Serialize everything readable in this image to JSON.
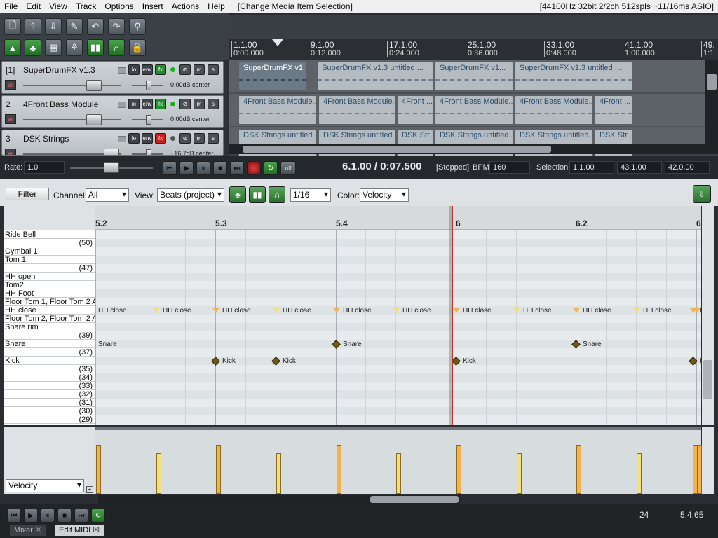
{
  "menu": {
    "items": [
      "File",
      "Edit",
      "View",
      "Track",
      "Options",
      "Insert",
      "Actions",
      "Help"
    ],
    "status": "[Change Media Item Selection]",
    "audio": "[44100Hz 32bit 2/2ch 512spls ~11/16ms ASIO]"
  },
  "tracks": [
    {
      "num": "[1]",
      "name": "SuperDrumFX v1.3",
      "vol": "0.00dB",
      "pan": "center",
      "fx_color": "green",
      "clips": [
        {
          "label": "SuperDrumFX v1...",
          "sel": true
        },
        {
          "label": "SuperDrumFX v1.3 untitled ..."
        },
        {
          "label": "SuperDrumFX v1..."
        },
        {
          "label": "SuperDrumFX v1.3 untitled ..."
        }
      ]
    },
    {
      "num": "2",
      "name": "4Front Bass Module",
      "vol": "0.00dB",
      "pan": "center",
      "fx_color": "green",
      "clips": [
        {
          "label": "4Front Bass Module..."
        },
        {
          "label": "4Front Bass Module..."
        },
        {
          "label": "4Front ..."
        },
        {
          "label": "4Front Bass Module..."
        },
        {
          "label": "4Front Bass Module..."
        },
        {
          "label": "4Front ..."
        }
      ]
    },
    {
      "num": "3",
      "name": "DSK Strings",
      "vol": "+16.7dB",
      "pan": "center",
      "fx_color": "red",
      "clips": [
        {
          "label": "DSK Strings untitled ..."
        },
        {
          "label": "DSK Strings untitled..."
        },
        {
          "label": "DSK Str..."
        },
        {
          "label": "DSK Strings untitled..."
        },
        {
          "label": "DSK Strings untitled..."
        },
        {
          "label": "DSK Str..."
        }
      ]
    }
  ],
  "ruler_top": [
    {
      "bar": "1.1.00",
      "time": "0:00.000"
    },
    {
      "bar": "9.1.00",
      "time": "0:12.000"
    },
    {
      "bar": "17.1.00",
      "time": "0:24.000"
    },
    {
      "bar": "25.1.00",
      "time": "0:36.000"
    },
    {
      "bar": "33.1.00",
      "time": "0:48.000"
    },
    {
      "bar": "41.1.00",
      "time": "1:00.000"
    },
    {
      "bar": "49.",
      "time": "1:1"
    }
  ],
  "transport": {
    "rate_label": "Rate:",
    "rate": "1.0",
    "position": "6.1.00 / 0:07.500",
    "state": "[Stopped]",
    "bpm_label": "BPM:",
    "bpm": "160",
    "selection_label": "Selection:",
    "sel_start": "1.1.00",
    "sel_end": "43.1.00",
    "sel_len": "42.0.00",
    "off": "off"
  },
  "midi_toolbar": {
    "filter": "Filter",
    "channel_label": "Channel:",
    "channel": "All",
    "view_label": "View:",
    "view": "Beats (project)",
    "grid": "1/16",
    "color_label": "Color:",
    "color": "Velocity"
  },
  "keys": [
    {
      "label": "Ride Bell"
    },
    {
      "label": "(50)",
      "num": true
    },
    {
      "label": "Cymbal 1"
    },
    {
      "label": "Tom 1"
    },
    {
      "label": "(47)",
      "num": true
    },
    {
      "label": "HH open"
    },
    {
      "label": "Tom2"
    },
    {
      "label": "HH Foot"
    },
    {
      "label": "Floor Tom 1, Floor Tom 2 A"
    },
    {
      "label": "HH close"
    },
    {
      "label": "Floor Tom 2, Floor Tom 2 A"
    },
    {
      "label": "Snare rim"
    },
    {
      "label": "(39)",
      "num": true
    },
    {
      "label": "Snare"
    },
    {
      "label": "(37)",
      "num": true
    },
    {
      "label": "Kick"
    },
    {
      "label": "(35)",
      "num": true
    },
    {
      "label": "(34)",
      "num": true
    },
    {
      "label": "(33)",
      "num": true
    },
    {
      "label": "(32)",
      "num": true
    },
    {
      "label": "(31)",
      "num": true
    },
    {
      "label": "(30)",
      "num": true
    },
    {
      "label": "(29)",
      "num": true
    }
  ],
  "grid_ruler": [
    "5.2",
    "5.3",
    "5.4",
    "6",
    "6.2",
    "6."
  ],
  "notes": {
    "hh": {
      "label": "HH close",
      "count": 11
    },
    "snare": {
      "label": "Snare"
    },
    "kick": {
      "label": "Kick"
    },
    "kick_partial": "K",
    "hh_partial": "H"
  },
  "velocity_lane": {
    "label": "Velocity"
  },
  "bottom": {
    "tab_mixer": "Mixer",
    "tab_edit": "Edit MIDI",
    "num1": "24",
    "num2": "5.4.65"
  },
  "colors": {
    "accent": "#1f8e2c",
    "record": "#c81f1f",
    "note_orange": "#f3b24d",
    "note_yellow": "#f3e07a",
    "kick": "#6e5a15"
  }
}
